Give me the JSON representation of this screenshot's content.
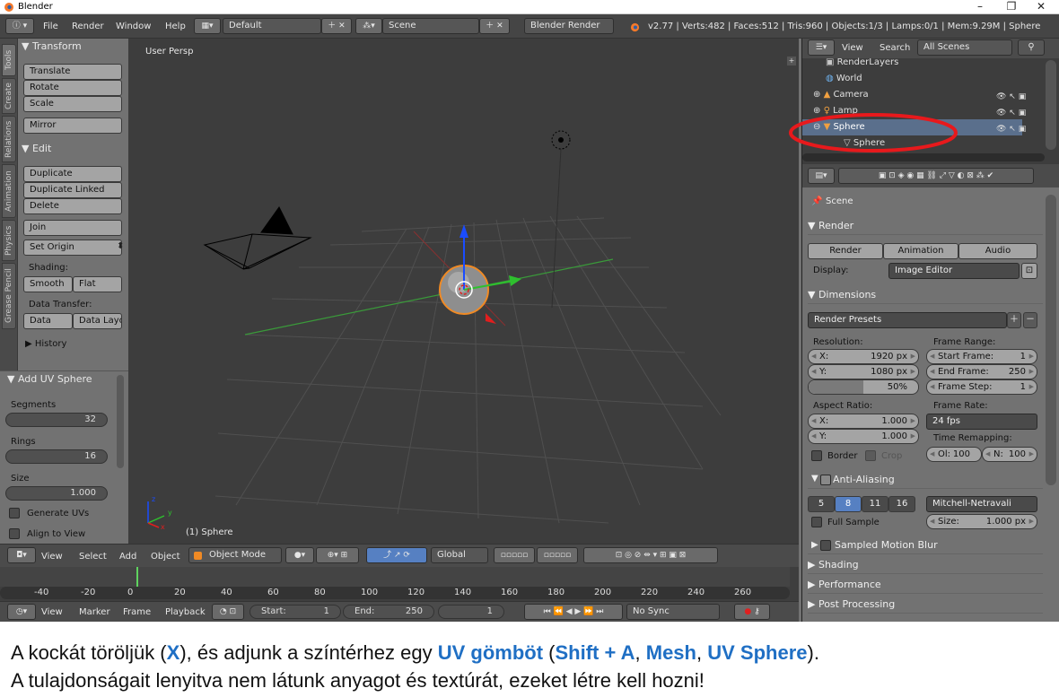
{
  "window": {
    "title": "Blender",
    "minimize": "–",
    "restore": "❐",
    "close": "✕"
  },
  "info_bar": {
    "menus": [
      "File",
      "Render",
      "Window",
      "Help"
    ],
    "layout": "Default",
    "scene": "Scene",
    "engine": "Blender Render",
    "stats": "v2.77 | Verts:482 | Faces:512 | Tris:960 | Objects:1/3 | Lamps:0/1 | Mem:9.29M | Sphere"
  },
  "tool_tabs": [
    "Tools",
    "Create",
    "Relations",
    "Animation",
    "Physics",
    "Grease Pencil"
  ],
  "toolshelf": {
    "transform": {
      "title": "▼ Transform",
      "buttons": [
        "Translate",
        "Rotate",
        "Scale",
        "Mirror"
      ]
    },
    "edit": {
      "title": "▼ Edit",
      "buttons": [
        "Duplicate",
        "Duplicate Linked",
        "Delete",
        "Join",
        "Set Origin"
      ],
      "shading_label": "Shading:",
      "smooth": "Smooth",
      "flat": "Flat",
      "data_transfer_label": "Data Transfer:",
      "data": "Data",
      "data_layo": "Data Layo"
    },
    "history": "▶ History"
  },
  "redo_panel": {
    "title": "▼ Add UV Sphere",
    "segments_label": "Segments",
    "segments": "32",
    "rings_label": "Rings",
    "rings": "16",
    "size_label": "Size",
    "size": "1.000",
    "generate_uvs": "Generate UVs",
    "align_to_view": "Align to View"
  },
  "viewport": {
    "label": "User Persp",
    "object_label": "(1) Sphere",
    "axis_x": "x",
    "axis_y": "y",
    "axis_z": "z"
  },
  "viewport_header": {
    "menus": [
      "View",
      "Select",
      "Add",
      "Object"
    ],
    "mode": "Object Mode",
    "orientation": "Global"
  },
  "timeline": {
    "ticks": [
      "-40",
      "-20",
      "0",
      "20",
      "40",
      "60",
      "80",
      "100",
      "120",
      "140",
      "160",
      "180",
      "200",
      "220",
      "240",
      "260"
    ],
    "menus": [
      "View",
      "Marker",
      "Frame",
      "Playback"
    ],
    "start_label": "Start:",
    "start": "1",
    "end_label": "End:",
    "end": "250",
    "current": "1",
    "sync": "No Sync"
  },
  "outliner": {
    "menus": [
      "View",
      "Search"
    ],
    "filter": "All Scenes",
    "rows": [
      "RenderLayers",
      "World",
      "Camera",
      "Lamp",
      "Sphere",
      "Sphere"
    ]
  },
  "properties": {
    "scene": "Scene",
    "render": {
      "title": "▼ Render",
      "render_btn": "Render",
      "animation_btn": "Animation",
      "audio_btn": "Audio",
      "display_label": "Display:",
      "display": "Image Editor"
    },
    "dimensions": {
      "title": "▼ Dimensions",
      "presets": "Render Presets",
      "resolution_label": "Resolution:",
      "res_x_label": "X:",
      "res_x": "1920 px",
      "res_y_label": "Y:",
      "res_y": "1080 px",
      "res_pct": "50%",
      "frame_range_label": "Frame Range:",
      "start_label": "Start Frame:",
      "start": "1",
      "end_label": "End Frame:",
      "end": "250",
      "step_label": "Frame Step:",
      "step": "1",
      "aspect_label": "Aspect Ratio:",
      "asp_x_label": "X:",
      "asp_x": "1.000",
      "asp_y_label": "Y:",
      "asp_y": "1.000",
      "frame_rate_label": "Frame Rate:",
      "frame_rate": "24 fps",
      "border": "Border",
      "crop": "Crop",
      "time_remap_label": "Time Remapping:",
      "old_label": "Ol:",
      "old": "100",
      "new_label": "N:",
      "new": "100"
    },
    "anti_aliasing": {
      "title": "Anti-Aliasing",
      "samples": [
        "5",
        "8",
        "11",
        "16"
      ],
      "filter": "Mitchell-Netravali",
      "full_sample": "Full Sample",
      "size_label": "Size:",
      "size": "1.000 px"
    },
    "collapsed": [
      "Sampled Motion Blur",
      "▶ Shading",
      "▶ Performance",
      "▶ Post Processing"
    ]
  },
  "caption": {
    "l1_a": "A kockát töröljük (",
    "key_x": "X",
    "l1_b": "), és adjunk a színtérhez egy ",
    "uv_gombot": "UV gömböt",
    "l1_c": " (",
    "shift_a": "Shift + A",
    "comma1": ", ",
    "mesh": "Mesh",
    "comma2": ", ",
    "uv_sphere": "UV Sphere",
    "l1_d": ").",
    "line2": "A tulajdonságait lenyitva nem látunk anyagot és textúrát, ezeket létre kell hozni!"
  },
  "colors": {
    "accent_blue": "#1f6fc4",
    "highlight_circle": "#e8191c",
    "selection_orange": "#f08a24"
  }
}
